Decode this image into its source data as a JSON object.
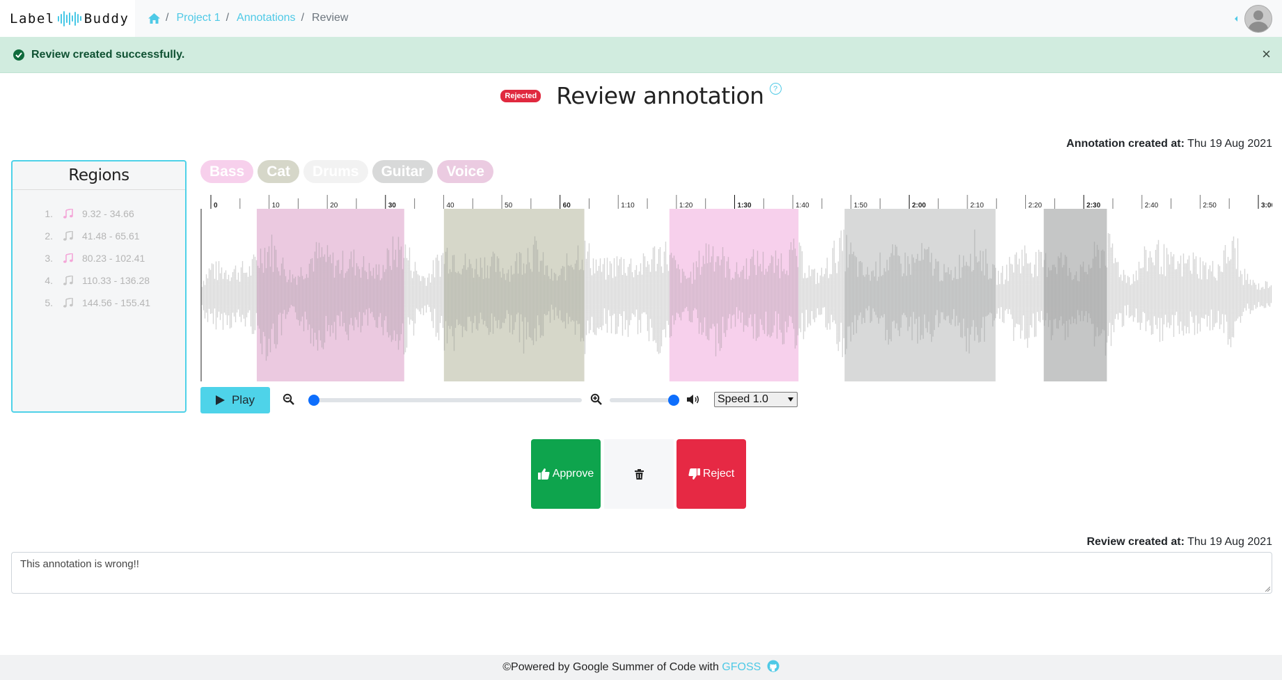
{
  "app": {
    "brand_left": "Label",
    "brand_right": "Buddy",
    "accent_color": "#4ec9e6"
  },
  "breadcrumb": {
    "home_icon": "home-icon",
    "items": [
      "Project 1",
      "Annotations"
    ],
    "current": "Review",
    "separator": "/"
  },
  "alert": {
    "message": "Review created successfully.",
    "close_label": "×",
    "icon": "check-circle-icon",
    "color": "#d1ecdf"
  },
  "review": {
    "status_badge": "Rejected",
    "status_color": "#e0293f",
    "title": "Review annotation",
    "help_label": "?",
    "annotation_created_label": "Annotation created at:",
    "annotation_created_value": "Thu 19 Aug 2021",
    "review_created_label": "Review created at:",
    "review_created_value": "Thu 19 Aug 2021",
    "comment": "This annotation is wrong!!"
  },
  "regions_panel": {
    "title": "Regions",
    "items": [
      {
        "index": "1.",
        "range": "9.32 - 34.66",
        "icon": "music-note-icon",
        "color": "#f4a6d8"
      },
      {
        "index": "2.",
        "range": "41.48 - 65.61",
        "icon": "music-note-icon",
        "color": "#c6c6c6"
      },
      {
        "index": "3.",
        "range": "80.23 - 102.41",
        "icon": "music-note-icon",
        "color": "#f4a6d8"
      },
      {
        "index": "4.",
        "range": "110.33 - 136.28",
        "icon": "music-note-icon",
        "color": "#c6c6c6"
      },
      {
        "index": "5.",
        "range": "144.56 - 155.41",
        "icon": "music-note-icon",
        "color": "#c6c6c6"
      }
    ]
  },
  "labels": [
    {
      "name": "Bass",
      "color": "#f7d0ec"
    },
    {
      "name": "Cat",
      "color": "#d6d7c9"
    },
    {
      "name": "Drums",
      "color": "#f2f2f2"
    },
    {
      "name": "Guitar",
      "color": "#d8d9d9"
    },
    {
      "name": "Voice",
      "color": "#ebcbe1"
    }
  ],
  "player": {
    "duration_seconds": 188,
    "timeline_labels": [
      "0",
      "10",
      "20",
      "30",
      "40",
      "50",
      "60",
      "1:10",
      "1:20",
      "1:30",
      "1:40",
      "1:50",
      "2:00",
      "2:10",
      "2:20",
      "2:30",
      "2:40",
      "2:50",
      "3:00"
    ],
    "regions": [
      {
        "start": 9.32,
        "end": 34.66,
        "color": "#ebc9e0"
      },
      {
        "start": 41.48,
        "end": 65.61,
        "color": "#d6d7c9"
      },
      {
        "start": 80.23,
        "end": 102.41,
        "color": "#f7d0ec"
      },
      {
        "start": 110.33,
        "end": 136.28,
        "color": "#d8d9d9"
      },
      {
        "start": 144.56,
        "end": 155.41,
        "color": "#c5c6c6"
      }
    ],
    "play_label": "Play",
    "zoom_out_icon": "zoom-out-icon",
    "zoom_in_icon": "zoom-in-icon",
    "zoom_level": 0,
    "volume_icon": "volume-icon",
    "volume_level": 1.0,
    "speed_value": "Speed 1.0"
  },
  "actions": {
    "approve_label": "Approve",
    "approve_icon": "thumbs-up-icon",
    "delete_icon": "trash-icon",
    "reject_label": "Reject",
    "reject_icon": "thumbs-down-icon"
  },
  "footer": {
    "text": "©Powered by Google Summer of Code with ",
    "link": "GFOSS",
    "icon": "github-icon"
  }
}
